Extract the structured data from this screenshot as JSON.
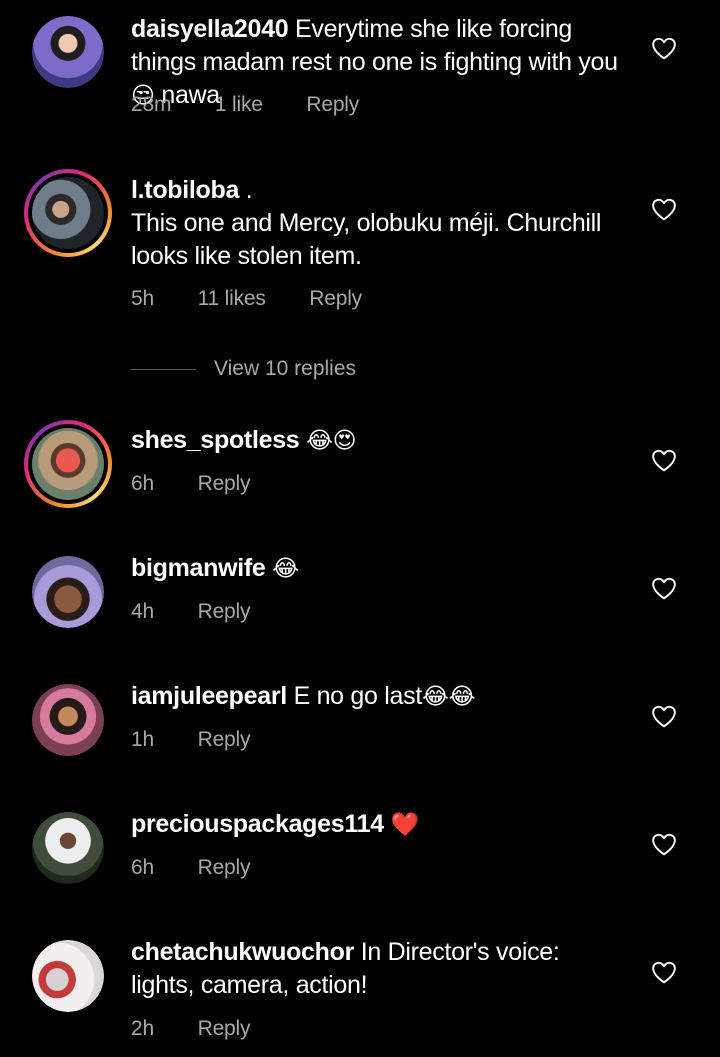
{
  "comments": [
    {
      "username": "daisyella2040",
      "text": "Everytime she like forcing things madam rest no one is fighting with you",
      "emoji": "😒",
      "text_after_emoji": "nawa",
      "time": "28m",
      "likes": "1 like",
      "reply": "Reply",
      "avatar_story_ring": false
    },
    {
      "username": "l.tobiloba",
      "username_suffix": ".",
      "text": "This one and Mercy, olobuku méji. Churchill looks like stolen item.",
      "time": "5h",
      "likes": "11 likes",
      "reply": "Reply",
      "avatar_story_ring": true,
      "view_replies": "View 10 replies"
    },
    {
      "username": "shes_spotless",
      "emoji": "😂😍",
      "time": "6h",
      "reply": "Reply",
      "avatar_story_ring": true
    },
    {
      "username": "bigmanwife",
      "emoji": "😂",
      "time": "4h",
      "reply": "Reply",
      "avatar_story_ring": false
    },
    {
      "username": "iamjuleepearl",
      "text": "E no go last",
      "emoji": "😂😂",
      "time": "1h",
      "reply": "Reply",
      "avatar_story_ring": false
    },
    {
      "username": "preciouspackages114",
      "emoji": "❤️",
      "time": "6h",
      "reply": "Reply",
      "avatar_story_ring": false
    },
    {
      "username": "chetachukwuochor",
      "text": "In Director's voice: lights, camera, action!",
      "time": "2h",
      "reply": "Reply",
      "avatar_story_ring": false
    }
  ],
  "colors": {
    "background": "#000000",
    "primary_text": "#ffffff",
    "secondary_text": "#a8a8a8",
    "heart_icon": "#ffffff",
    "story_ring": [
      "#f58529",
      "#dd2a7b",
      "#8134af",
      "#feda77"
    ]
  },
  "icons": {
    "like": "heart-outline-icon"
  }
}
